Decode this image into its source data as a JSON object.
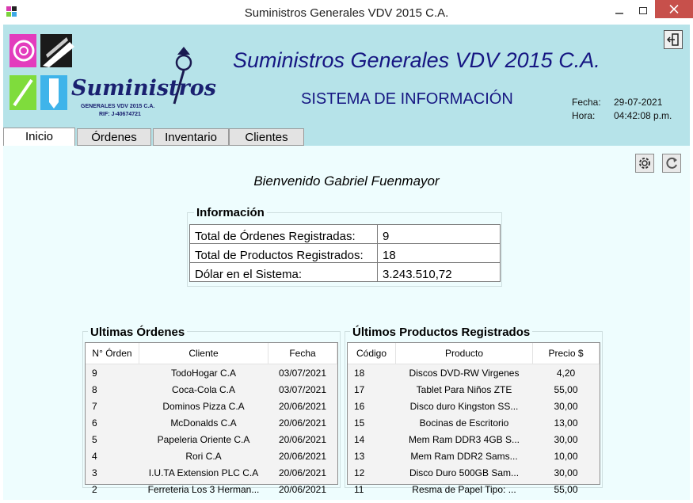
{
  "window": {
    "title": "Suministros Generales VDV 2015 C.A."
  },
  "logo": {
    "word": "Suministros",
    "line1": "GENERALES VDV 2015 C.A.",
    "line2": "RIF: J-40674721"
  },
  "header": {
    "brand": "Suministros Generales VDV 2015 C.A.",
    "system": "SISTEMA DE INFORMACIÓN",
    "fecha_label": "Fecha:",
    "fecha_value": "29-07-2021",
    "hora_label": "Hora:",
    "hora_value": "04:42:08 p.m."
  },
  "tabs": [
    {
      "label": "Inicio"
    },
    {
      "label": "Órdenes"
    },
    {
      "label": "Inventario"
    },
    {
      "label": "Clientes"
    }
  ],
  "welcome": "Bienvenido Gabriel Fuenmayor",
  "info": {
    "title": "Información",
    "rows": [
      {
        "label": "Total de Órdenes Registradas:",
        "value": "9"
      },
      {
        "label": "Total de Productos Registrados:",
        "value": "18"
      },
      {
        "label": "Dólar en el Sistema:",
        "value": "3.243.510,72"
      }
    ]
  },
  "orders": {
    "title": "Ultimas Órdenes",
    "columns": [
      "N° Órden",
      "Cliente",
      "Fecha"
    ],
    "rows": [
      [
        "9",
        "TodoHogar C.A",
        "03/07/2021"
      ],
      [
        "8",
        "Coca-Cola C.A",
        "03/07/2021"
      ],
      [
        "7",
        "Dominos Pizza C.A",
        "20/06/2021"
      ],
      [
        "6",
        "McDonalds C.A",
        "20/06/2021"
      ],
      [
        "5",
        "Papeleria Oriente C.A",
        "20/06/2021"
      ],
      [
        "4",
        "Rori C.A",
        "20/06/2021"
      ],
      [
        "3",
        "I.U.TA Extension PLC C.A",
        "20/06/2021"
      ],
      [
        "2",
        "Ferreteria Los 3 Herman...",
        "20/06/2021"
      ]
    ]
  },
  "products": {
    "title": "Últimos Productos Registrados",
    "columns": [
      "Código",
      "Producto",
      "Precio $"
    ],
    "rows": [
      [
        "18",
        "Discos DVD-RW Virgenes",
        "4,20"
      ],
      [
        "17",
        "Tablet Para Niños ZTE",
        "55,00"
      ],
      [
        "16",
        "Disco duro Kingston SS...",
        "30,00"
      ],
      [
        "15",
        "Bocinas de Escritorio",
        "13,00"
      ],
      [
        "14",
        "Mem Ram DDR3 4GB S...",
        "30,00"
      ],
      [
        "13",
        "Mem Ram DDR2 Sams...",
        "10,00"
      ],
      [
        "12",
        "Disco Duro 500GB Sam...",
        "30,00"
      ],
      [
        "11",
        "Resma de Papel Tipo: ...",
        "55,00"
      ]
    ]
  },
  "colors": {
    "header_bg": "#b6e3e9",
    "content_bg": "#eefdfe",
    "title_blue": "#161682",
    "close_red": "#c7504b"
  }
}
